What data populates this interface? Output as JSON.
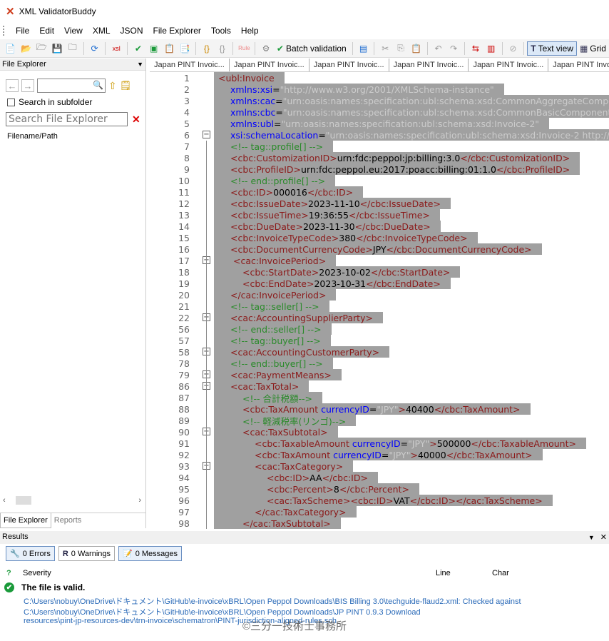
{
  "window": {
    "title": "XML ValidatorBuddy"
  },
  "menu": [
    "File",
    "Edit",
    "View",
    "XML",
    "JSON",
    "File Explorer",
    "Tools",
    "Help"
  ],
  "toolbar": {
    "batch_label": "Batch validation",
    "textview_label": "Text view",
    "grid_label": "Grid"
  },
  "file_explorer": {
    "header": "File Explorer",
    "search_subfolder_label": "Search in subfolder",
    "search_placeholder": "Search File Explorer",
    "column_header": "Filename/Path",
    "tabs": [
      "File Explorer",
      "Reports"
    ]
  },
  "doc_tabs": [
    "Japan PINT Invoic...",
    "Japan PINT Invoic...",
    "Japan PINT Invoic...",
    "Japan PINT Invoic...",
    "Japan PINT Invoic...",
    "Japan PINT Invoic...",
    "J"
  ],
  "editor_lines": [
    {
      "n": "1",
      "fold": "",
      "indent": 0,
      "parts": [
        [
          "t",
          "<ubl:Invoice"
        ]
      ]
    },
    {
      "n": "2",
      "fold": "",
      "indent": 1,
      "parts": [
        [
          "a",
          "xmlns:xsi"
        ],
        [
          "x",
          "="
        ],
        [
          "v",
          "\"http://www.w3.org/2001/XMLSchema-instance\""
        ]
      ]
    },
    {
      "n": "3",
      "fold": "",
      "indent": 1,
      "parts": [
        [
          "a",
          "xmlns:cac"
        ],
        [
          "x",
          "="
        ],
        [
          "v",
          "\"urn:oasis:names:specification:ubl:schema:xsd:CommonAggregateCompo"
        ]
      ]
    },
    {
      "n": "4",
      "fold": "",
      "indent": 1,
      "parts": [
        [
          "a",
          "xmlns:cbc"
        ],
        [
          "x",
          "="
        ],
        [
          "v",
          "\"urn:oasis:names:specification:ubl:schema:xsd:CommonBasicComponents"
        ]
      ]
    },
    {
      "n": "5",
      "fold": "",
      "indent": 1,
      "parts": [
        [
          "a",
          "xmlns:ubl"
        ],
        [
          "x",
          "="
        ],
        [
          "v",
          "\"urn:oasis:names:specification:ubl:schema:xsd:Invoice-2\""
        ]
      ]
    },
    {
      "n": "6",
      "fold": "-",
      "indent": 1,
      "parts": [
        [
          "a",
          "xsi:schemaLocation"
        ],
        [
          "x",
          "="
        ],
        [
          "v",
          "\"urn:oasis:names:specification:ubl:schema:xsd:Invoice-2 http://"
        ]
      ]
    },
    {
      "n": "7",
      "fold": "",
      "indent": 1,
      "parts": [
        [
          "c",
          "<!-- tag::profile[] -->"
        ]
      ]
    },
    {
      "n": "8",
      "fold": "",
      "indent": 1,
      "parts": [
        [
          "t",
          "<cbc:CustomizationID>"
        ],
        [
          "x",
          "urn:fdc:peppol:jp:billing:3.0"
        ],
        [
          "t",
          "</cbc:CustomizationID>"
        ]
      ]
    },
    {
      "n": "9",
      "fold": "",
      "indent": 1,
      "parts": [
        [
          "t",
          "<cbc:ProfileID>"
        ],
        [
          "x",
          "urn:fdc:peppol.eu:2017:poacc:billing:01:1.0"
        ],
        [
          "t",
          "</cbc:ProfileID>"
        ]
      ]
    },
    {
      "n": "10",
      "fold": "",
      "indent": 1,
      "parts": [
        [
          "c",
          "<!-- end::profile[] -->"
        ]
      ]
    },
    {
      "n": "11",
      "fold": "",
      "indent": 1,
      "parts": [
        [
          "t",
          "<cbc:ID>"
        ],
        [
          "x",
          "000016"
        ],
        [
          "t",
          "</cbc:ID>"
        ]
      ]
    },
    {
      "n": "12",
      "fold": "",
      "indent": 1,
      "parts": [
        [
          "t",
          "<cbc:IssueDate>"
        ],
        [
          "x",
          "2023-11-10"
        ],
        [
          "t",
          "</cbc:IssueDate>"
        ]
      ]
    },
    {
      "n": "13",
      "fold": "",
      "indent": 1,
      "parts": [
        [
          "t",
          "<cbc:IssueTime>"
        ],
        [
          "x",
          "19:36:55"
        ],
        [
          "t",
          "</cbc:IssueTime>"
        ]
      ]
    },
    {
      "n": "14",
      "fold": "",
      "indent": 1,
      "parts": [
        [
          "t",
          "<cbc:DueDate>"
        ],
        [
          "x",
          "2023-11-30"
        ],
        [
          "t",
          "</cbc:DueDate>"
        ]
      ]
    },
    {
      "n": "15",
      "fold": "",
      "indent": 1,
      "parts": [
        [
          "t",
          "<cbc:InvoiceTypeCode>"
        ],
        [
          "x",
          "380"
        ],
        [
          "t",
          "</cbc:InvoiceTypeCode>"
        ]
      ]
    },
    {
      "n": "16",
      "fold": "",
      "indent": 1,
      "parts": [
        [
          "t",
          "<cbc:DocumentCurrencyCode>"
        ],
        [
          "x",
          "JPY"
        ],
        [
          "t",
          "</cbc:DocumentCurrencyCode>"
        ]
      ]
    },
    {
      "n": "17",
      "fold": "-",
      "indent": 1,
      "parts": [
        [
          "t",
          " <cac:InvoicePeriod>"
        ]
      ]
    },
    {
      "n": "18",
      "fold": "",
      "indent": 2,
      "parts": [
        [
          "t",
          "<cbc:StartDate>"
        ],
        [
          "x",
          "2023-10-02"
        ],
        [
          "t",
          "</cbc:StartDate>"
        ]
      ]
    },
    {
      "n": "19",
      "fold": "",
      "indent": 2,
      "parts": [
        [
          "t",
          "<cbc:EndDate>"
        ],
        [
          "x",
          "2023-10-31"
        ],
        [
          "t",
          "</cbc:EndDate>"
        ]
      ]
    },
    {
      "n": "20",
      "fold": "",
      "indent": 1,
      "parts": [
        [
          "t",
          "</cac:InvoicePeriod>"
        ]
      ]
    },
    {
      "n": "21",
      "fold": "",
      "indent": 1,
      "parts": [
        [
          "c",
          "<!-- tag::seller[] -->"
        ]
      ]
    },
    {
      "n": "22",
      "fold": "+",
      "indent": 1,
      "parts": [
        [
          "t",
          "<cac:AccountingSupplierParty>"
        ]
      ]
    },
    {
      "n": "56",
      "fold": "",
      "indent": 1,
      "parts": [
        [
          "c",
          "<!-- end::seller[] -->"
        ]
      ]
    },
    {
      "n": "57",
      "fold": "",
      "indent": 1,
      "parts": [
        [
          "c",
          "<!-- tag::buyer[] -->"
        ]
      ]
    },
    {
      "n": "58",
      "fold": "+",
      "indent": 1,
      "parts": [
        [
          "t",
          "<cac:AccountingCustomerParty>"
        ]
      ]
    },
    {
      "n": "78",
      "fold": "",
      "indent": 1,
      "parts": [
        [
          "c",
          "<!-- end::buyer[] -->"
        ]
      ]
    },
    {
      "n": "79",
      "fold": "+",
      "indent": 1,
      "parts": [
        [
          "t",
          "<cac:PaymentMeans>"
        ]
      ]
    },
    {
      "n": "86",
      "fold": "-",
      "indent": 1,
      "parts": [
        [
          "t",
          "<cac:TaxTotal>"
        ]
      ]
    },
    {
      "n": "87",
      "fold": "",
      "indent": 2,
      "parts": [
        [
          "c",
          "<!-- 合計税額-->"
        ]
      ]
    },
    {
      "n": "88",
      "fold": "",
      "indent": 2,
      "parts": [
        [
          "t",
          "<cbc:TaxAmount "
        ],
        [
          "a",
          "currencyID"
        ],
        [
          "x",
          "="
        ],
        [
          "v",
          "\"JPY\""
        ],
        [
          "t",
          ">"
        ],
        [
          "x",
          "40400"
        ],
        [
          "t",
          "</cbc:TaxAmount>"
        ]
      ]
    },
    {
      "n": "89",
      "fold": "",
      "indent": 2,
      "parts": [
        [
          "c",
          "<!-- 軽減税率(リンゴ)-->"
        ]
      ]
    },
    {
      "n": "90",
      "fold": "-",
      "indent": 2,
      "parts": [
        [
          "t",
          "<cac:TaxSubtotal>"
        ]
      ]
    },
    {
      "n": "91",
      "fold": "",
      "indent": 3,
      "parts": [
        [
          "t",
          "<cbc:TaxableAmount "
        ],
        [
          "a",
          "currencyID"
        ],
        [
          "x",
          "="
        ],
        [
          "v",
          "\"JPY\""
        ],
        [
          "t",
          ">"
        ],
        [
          "x",
          "500000"
        ],
        [
          "t",
          "</cbc:TaxableAmount>"
        ]
      ]
    },
    {
      "n": "92",
      "fold": "",
      "indent": 3,
      "parts": [
        [
          "t",
          "<cbc:TaxAmount "
        ],
        [
          "a",
          "currencyID"
        ],
        [
          "x",
          "="
        ],
        [
          "v",
          "\"JPY\""
        ],
        [
          "t",
          ">"
        ],
        [
          "x",
          "40000"
        ],
        [
          "t",
          "</cbc:TaxAmount>"
        ]
      ]
    },
    {
      "n": "93",
      "fold": "-",
      "indent": 3,
      "parts": [
        [
          "t",
          "<cac:TaxCategory>"
        ]
      ]
    },
    {
      "n": "94",
      "fold": "",
      "indent": 4,
      "parts": [
        [
          "t",
          "<cbc:ID>"
        ],
        [
          "x",
          "AA"
        ],
        [
          "t",
          "</cbc:ID>"
        ]
      ]
    },
    {
      "n": "95",
      "fold": "",
      "indent": 4,
      "parts": [
        [
          "t",
          "<cbc:Percent>"
        ],
        [
          "x",
          "8"
        ],
        [
          "t",
          "</cbc:Percent>"
        ]
      ]
    },
    {
      "n": "96",
      "fold": "",
      "indent": 4,
      "parts": [
        [
          "t",
          "<cac:TaxScheme>"
        ],
        [
          "t",
          "<cbc:ID>"
        ],
        [
          "x",
          "VAT"
        ],
        [
          "t",
          "</cbc:ID>"
        ],
        [
          "t",
          "</cac:TaxScheme>"
        ]
      ]
    },
    {
      "n": "97",
      "fold": "",
      "indent": 3,
      "parts": [
        [
          "t",
          "</cac:TaxCategory>"
        ]
      ]
    },
    {
      "n": "98",
      "fold": "",
      "indent": 2,
      "parts": [
        [
          "t",
          "</cac:TaxSubtotal>"
        ]
      ]
    }
  ],
  "results": {
    "header": "Results",
    "errors": "0 Errors",
    "warnings": "0 Warnings",
    "messages": "0 Messages",
    "col_severity": "Severity",
    "col_line": "Line",
    "col_char": "Char",
    "valid_text": "The file is valid.",
    "msg1": "C:\\Users\\nobuy\\OneDrive\\ドキュメント\\GitHub\\e-invoice\\xBRL\\Open Peppol Downloads\\BIS Billing 3.0\\techguide-flaud2.xml: Checked against",
    "msg2": "C:\\Users\\nobuy\\OneDrive\\ドキュメント\\GitHub\\e-invoice\\xBRL\\Open Peppol Downloads\\JP PINT 0.9.3 Download",
    "msg3": "resources\\pint-jp-resources-dev\\trn-invoice\\schematron\\PINT-jurisdiction-aligned-rules.sch"
  },
  "watermark": "©三分一技術士事務所"
}
